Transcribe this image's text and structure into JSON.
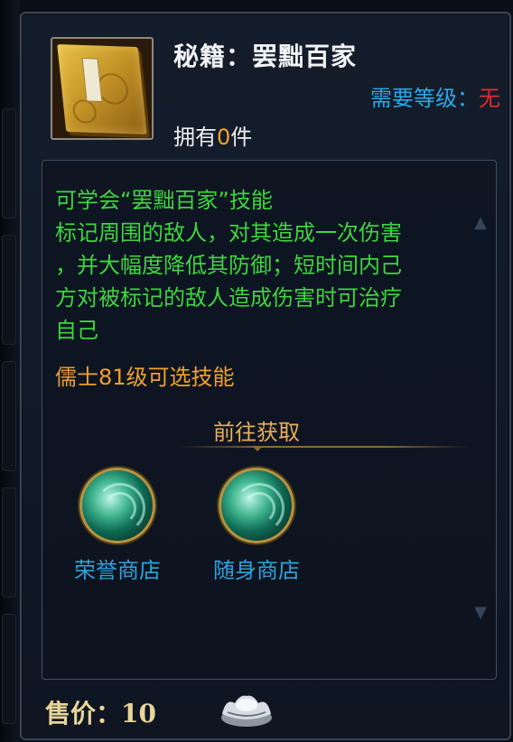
{
  "item": {
    "title": "秘籍：罢黜百家",
    "level_label": "需要等级：",
    "level_value": "无",
    "own_prefix": "拥有",
    "own_count": "0",
    "own_suffix": "件",
    "icon": "golden-book-icon"
  },
  "description": {
    "lines": [
      "可学会“罢黜百家”技能",
      "标记周围的敌人，对其造成一次伤害",
      "，并大幅度降低其防御；短时间内己",
      "方对被标记的敌人造成伤害时可治疗",
      "自己"
    ],
    "class_requirement": "儒士81级可选技能"
  },
  "acquire": {
    "title": "前往获取",
    "shops": [
      {
        "label": "荣誉商店",
        "icon": "jade-swirl-icon"
      },
      {
        "label": "随身商店",
        "icon": "jade-swirl-icon"
      }
    ]
  },
  "footer": {
    "price_label": "售价：",
    "price_value": "10",
    "currency_icon": "silver-ingot-icon"
  },
  "colors": {
    "desc_green": "#3ed53e",
    "level_blue": "#29a9e6",
    "level_red": "#e52b2b",
    "orange": "#f0a02e",
    "shop_blue": "#2ea3dd"
  }
}
